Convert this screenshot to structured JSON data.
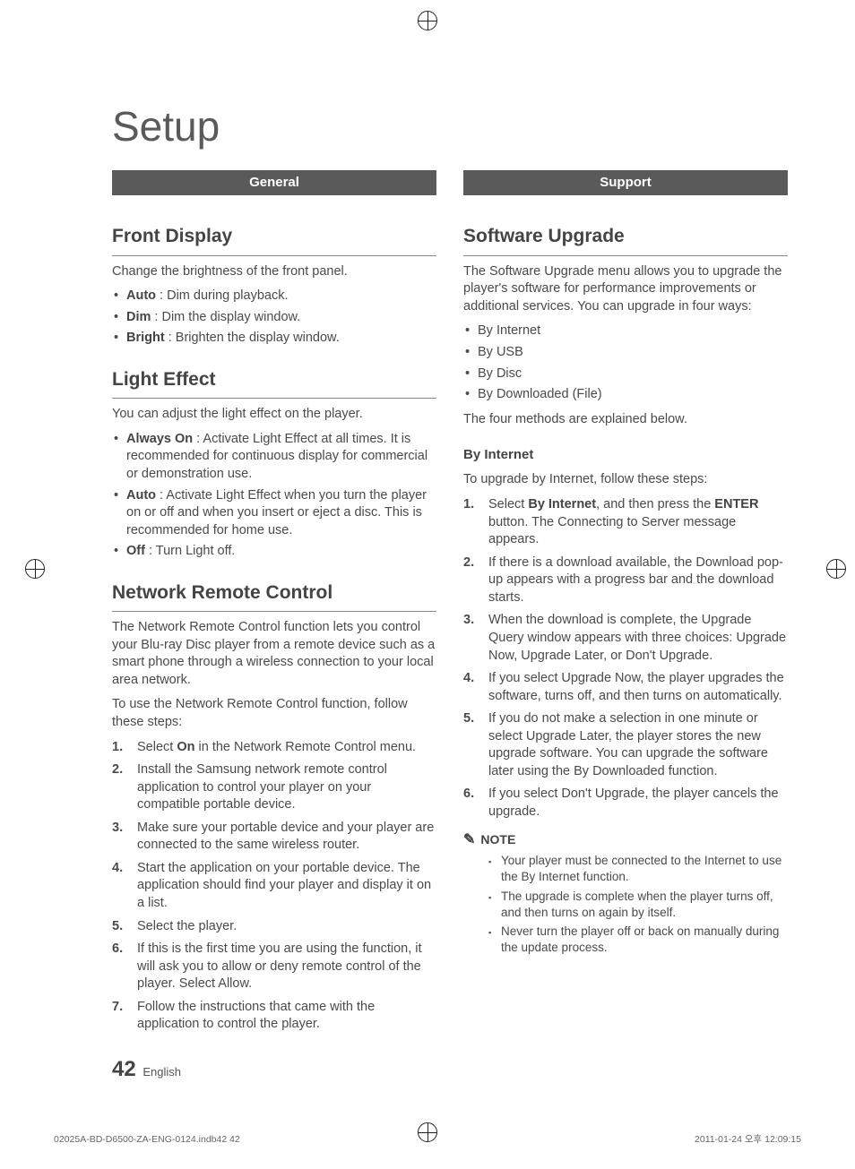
{
  "page": {
    "title": "Setup",
    "number": "42",
    "language": "English"
  },
  "print": {
    "left": "02025A-BD-D6500-ZA-ENG-0124.indb42   42",
    "right": "2011-01-24   오후 12:09:15"
  },
  "left": {
    "bar": "General",
    "s1": {
      "heading": "Front Display",
      "intro": "Change the brightness of the front panel.",
      "items": [
        {
          "b": "Auto",
          "t": " : Dim during playback."
        },
        {
          "b": "Dim",
          "t": " : Dim the display window."
        },
        {
          "b": "Bright",
          "t": " : Brighten the display window."
        }
      ]
    },
    "s2": {
      "heading": "Light Effect",
      "intro": "You can adjust the light effect on the player.",
      "items": [
        {
          "b": "Always On",
          "t": " : Activate Light Effect at all times. It is recommended for continuous display for commercial or demonstration use."
        },
        {
          "b": "Auto",
          "t": " : Activate Light Effect when you turn the player on or off and when you insert or eject a disc. This is recommended for home use."
        },
        {
          "b": "Off",
          "t": " : Turn Light off."
        }
      ]
    },
    "s3": {
      "heading": "Network Remote Control",
      "p1": "The Network Remote Control function lets you control your Blu-ray Disc player from a remote device such as a smart phone through a wireless connection to your local area network.",
      "p2": "To use the Network Remote Control function, follow these steps:",
      "steps": {
        "1a": "Select ",
        "1b": "On",
        "1c": " in the Network Remote Control menu.",
        "2": "Install the Samsung network remote control application to control your player on your compatible portable device.",
        "3": "Make sure your portable device and your player are connected to the same wireless router.",
        "4": "Start the application on your portable device. The application should find your player and display it on a list.",
        "5": "Select the player.",
        "6": "If this is the first time you are using the function, it will ask you to allow or deny remote control of the player. Select Allow.",
        "7": "Follow the instructions that came with the application to control the player."
      }
    }
  },
  "right": {
    "bar": "Support",
    "s1": {
      "heading": "Software Upgrade",
      "intro": "The Software Upgrade menu allows you to upgrade the player's software for performance improvements or additional services. You can upgrade in four ways:",
      "ways": [
        "By Internet",
        "By USB",
        "By Disc",
        "By Downloaded (File)"
      ],
      "outro": "The four methods are explained below."
    },
    "s2": {
      "heading": "By Internet",
      "intro": "To upgrade by Internet, follow these steps:",
      "steps": {
        "1a": "Select ",
        "1b": "By Internet",
        "1c": ", and then press the ",
        "1d": "ENTER",
        "1e": " button. The Connecting to Server message appears.",
        "2": "If there is a download available, the Download pop-up appears with a progress bar and the download starts.",
        "3": "When the download is complete, the Upgrade Query window appears with three choices: Upgrade Now, Upgrade Later, or Don't Upgrade.",
        "4": "If you select Upgrade Now, the player upgrades the software, turns off, and then turns on automatically.",
        "5": "If you do not make a selection in one minute or select Upgrade Later, the player stores the new upgrade software. You can upgrade the software later using the By Downloaded function.",
        "6": "If you select Don't Upgrade, the player cancels the upgrade."
      },
      "note_label": "NOTE",
      "notes": [
        "Your player must be connected to the Internet to use the By Internet function.",
        "The upgrade is complete when the player turns off, and then turns on again by itself.",
        "Never turn the player off or back on manually during the update process."
      ]
    }
  }
}
